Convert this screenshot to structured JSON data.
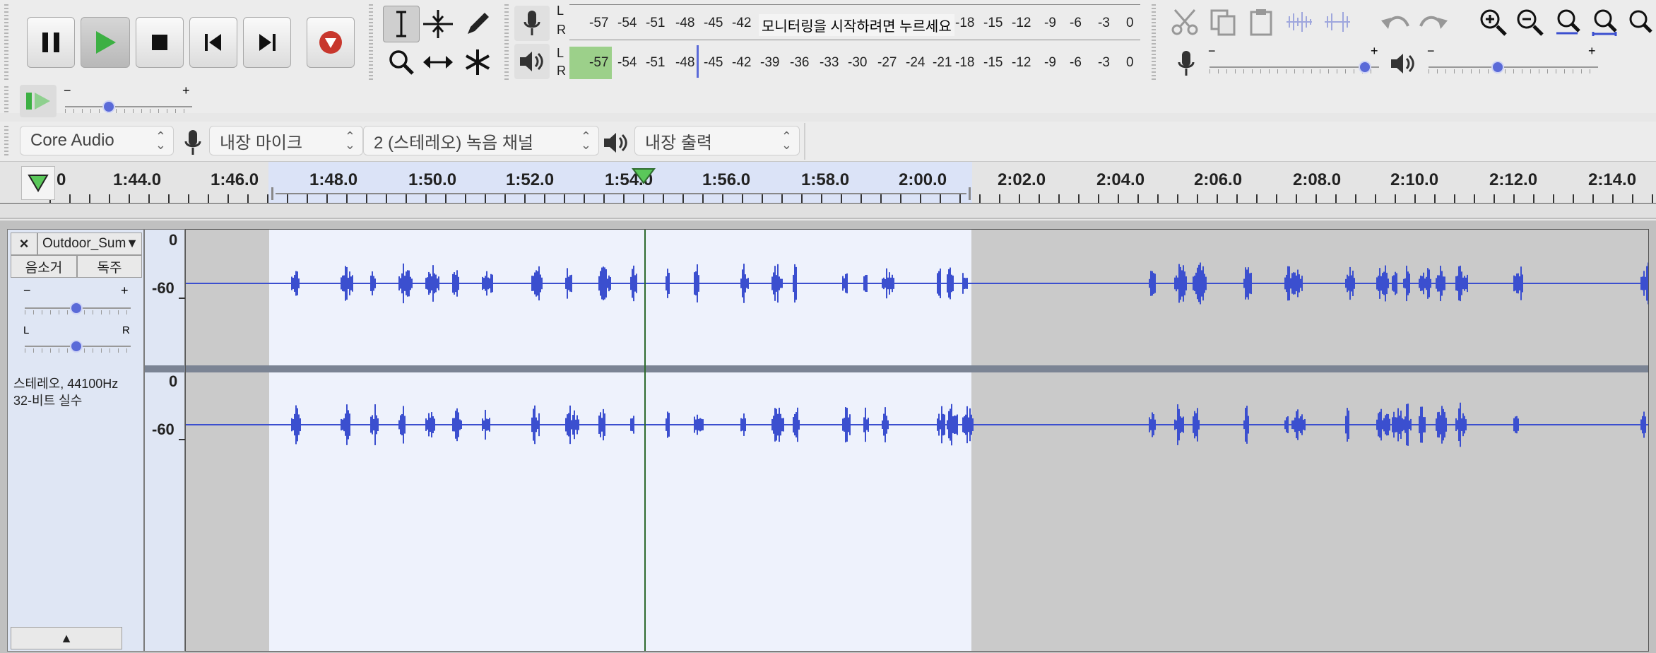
{
  "transport": {
    "buttons": [
      {
        "name": "pause-button",
        "icon": "pause-icon"
      },
      {
        "name": "play-button",
        "icon": "play-icon"
      },
      {
        "name": "stop-button",
        "icon": "stop-icon"
      },
      {
        "name": "skip-to-start-button",
        "icon": "skip-start-icon"
      },
      {
        "name": "skip-to-end-button",
        "icon": "skip-end-icon"
      },
      {
        "name": "record-button",
        "icon": "record-icon"
      }
    ]
  },
  "tools": [
    "selection-tool",
    "envelope-tool",
    "draw-tool",
    "zoom-tool",
    "time-shift-tool",
    "multi-tool"
  ],
  "meters": {
    "record_label_L": "L",
    "record_label_R": "R",
    "play_label_L": "L",
    "play_label_R": "R",
    "record_ticks": [
      "-57",
      "-54",
      "-51",
      "-48",
      "-45",
      "-42",
      "-18",
      "-15",
      "-12",
      "-9",
      "-6",
      "-3",
      "0"
    ],
    "record_prompt": "모니터링을 시작하려면 누르세요",
    "play_ticks": [
      "-57",
      "-54",
      "-51",
      "-48",
      "-45",
      "-42",
      "-39",
      "-36",
      "-33",
      "-30",
      "-27",
      "-24",
      "-21",
      "-18",
      "-15",
      "-12",
      "-9",
      "-6",
      "-3",
      "0"
    ]
  },
  "mixer": {
    "minus": "−",
    "plus": "+",
    "record_volume_level": 0.95,
    "play_volume_level": 0.4
  },
  "play_at_speed": {
    "minus": "−",
    "plus": "+",
    "level": 0.33
  },
  "device_bar": {
    "host": "Core Audio",
    "input": "내장 마이크",
    "channels": "2 (스테레오) 녹음 채널",
    "output": "내장 출력"
  },
  "timeline": {
    "labels": [
      "0",
      "1:44.0",
      "1:46.0",
      "1:48.0",
      "1:50.0",
      "1:52.0",
      "1:54.0",
      "1:56.0",
      "1:58.0",
      "2:00.0",
      "2:02.0",
      "2:04.0",
      "2:06.0",
      "2:08.0",
      "2:10.0",
      "2:12.0",
      "2:14.0"
    ]
  },
  "track": {
    "name": "Outdoor_Sum",
    "mute": "음소거",
    "solo": "독주",
    "gain_minus": "−",
    "gain_plus": "+",
    "pan_left": "L",
    "pan_right": "R",
    "info_line1": "스테레오, 44100Hz",
    "info_line2": "32-비트 실수",
    "scale_top": "0",
    "scale_mid": "-60",
    "scale_top2": "0",
    "scale_mid2": "-60"
  },
  "colors": {
    "waveform": "#3b4fcf",
    "selection": "#eef2fc",
    "unselected": "#cacaca",
    "playhead": "#2e6b2e",
    "record_red": "#c8372d",
    "play_green": "#3cb043"
  }
}
